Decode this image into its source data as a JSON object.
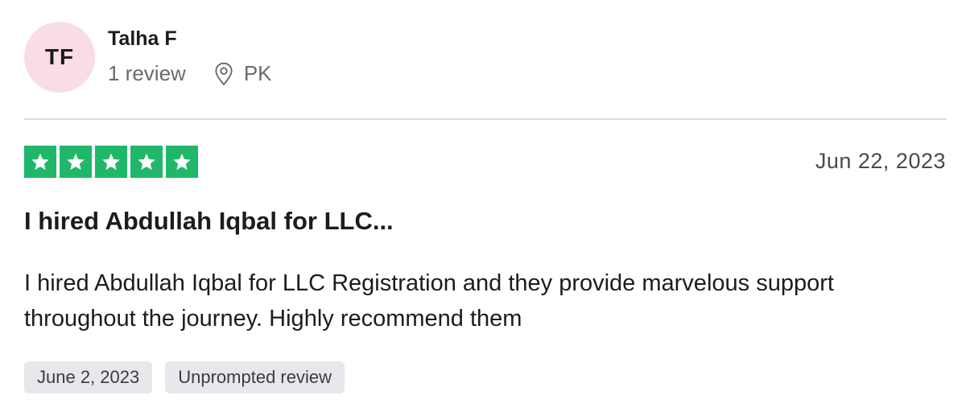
{
  "reviewer": {
    "initials": "TF",
    "name": "Talha F",
    "review_count": "1 review",
    "location_icon": "map-pin-icon",
    "country": "PK",
    "avatar_color": "#f8dde5"
  },
  "review": {
    "rating": 5,
    "rating_max": 5,
    "star_color": "#20b76b",
    "date": "Jun 22, 2023",
    "title": "I hired Abdullah Iqbal for LLC...",
    "body": "I hired Abdullah Iqbal for LLC Registration and they provide marvelous support throughout the journey. Highly recommend them",
    "tags": {
      "experience_date": "June 2, 2023",
      "review_type": "Unprompted review"
    }
  }
}
